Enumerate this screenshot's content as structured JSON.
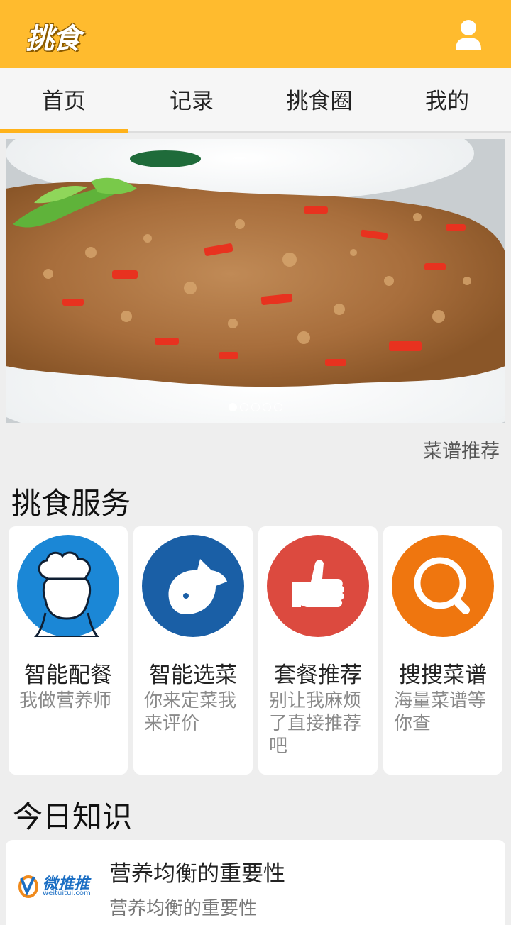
{
  "app": {
    "logo_text": "挑食",
    "user_icon": "user-icon",
    "brand_color": "#ffbb2e"
  },
  "tabs": [
    {
      "label": "首页",
      "selected": true
    },
    {
      "label": "记录",
      "selected": false
    },
    {
      "label": "挑食圈",
      "selected": false
    },
    {
      "label": "我的",
      "selected": false
    }
  ],
  "banner": {
    "caption": "菜谱推荐",
    "slide_count": 5,
    "active_slide": 1
  },
  "services": {
    "title": "挑食服务",
    "items": [
      {
        "title": "智能配餐",
        "desc": "我做营养师",
        "icon": "chef-icon",
        "color": "#1b87d6"
      },
      {
        "title": "智能选菜",
        "desc": "你来定菜我来评价",
        "icon": "fish-icon",
        "color": "#1a5fa6"
      },
      {
        "title": "套餐推荐",
        "desc": "别让我麻烦了直接推荐吧",
        "icon": "thumbs-up-icon",
        "color": "#dc4a3f"
      },
      {
        "title": "搜搜菜谱",
        "desc": "海量菜谱等你查",
        "icon": "search-icon",
        "color": "#ef760f"
      }
    ]
  },
  "knowledge": {
    "title": "今日知识",
    "item": {
      "title": "营养均衡的重要性",
      "subtitle": "营养均衡的重要性",
      "logo_text": "微推推",
      "logo_sub": "weituitui.com"
    }
  }
}
